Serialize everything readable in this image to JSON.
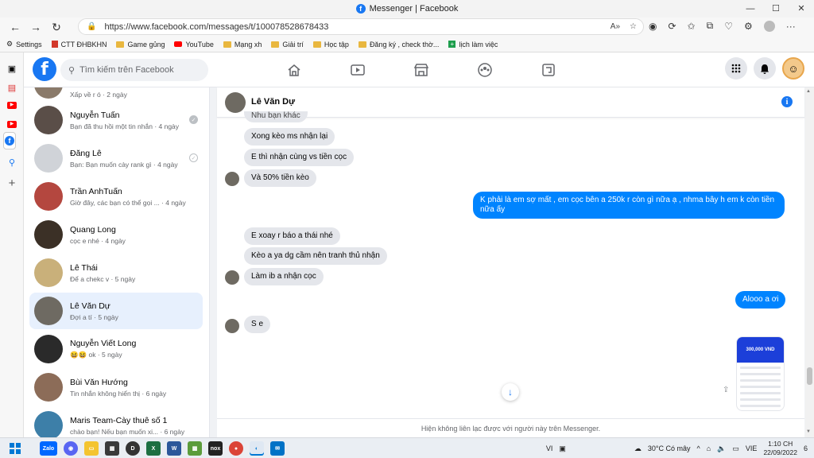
{
  "window": {
    "title": "Messenger | Facebook",
    "controls": [
      "—",
      "☐",
      "✕"
    ]
  },
  "browser": {
    "url": "https://www.facebook.com/messages/t/100078528678433"
  },
  "bookmarks": [
    {
      "label": "Settings",
      "icon": "gear-icon"
    },
    {
      "label": "CTT ĐHBKHN",
      "icon": "ctt-icon"
    },
    {
      "label": "Game gủng",
      "icon": "folder-icon"
    },
    {
      "label": "YouTube",
      "icon": "youtube-icon"
    },
    {
      "label": "Mạng xh",
      "icon": "folder-icon"
    },
    {
      "label": "Giải trí",
      "icon": "folder-icon"
    },
    {
      "label": "Học tập",
      "icon": "folder-icon"
    },
    {
      "label": "Đăng ký , check thờ...",
      "icon": "folder-icon"
    },
    {
      "label": "lịch làm việc",
      "icon": "sheet-icon"
    }
  ],
  "facebook": {
    "search_placeholder": "Tìm kiếm trên Facebook",
    "nav": [
      "home-icon",
      "watch-icon",
      "marketplace-icon",
      "groups-icon",
      "gaming-icon"
    ],
    "header_right": [
      "menu-grid-icon",
      "messenger-icon",
      "profile-avatar"
    ]
  },
  "conversations": {
    "partial_top": "Xấp về r ó · 2 ngày",
    "items": [
      {
        "name": "Nguyễn Tuấn",
        "preview": "Bạn đã thu hồi một tin nhắn · 4 ngày",
        "status": "seen-grey",
        "avatar_color": "#5a4e48"
      },
      {
        "name": "Đăng Lê",
        "preview": "Bạn: Bạn muốn cày rank gì · 4 ngày",
        "status": "sent-outline",
        "avatar_color": "#d0d3d8"
      },
      {
        "name": "Trần AnhTuấn",
        "preview": "Giờ đây, các bạn có thể gọi ... · 4 ngày",
        "status": "",
        "avatar_color": "#b4473f"
      },
      {
        "name": "Quang Long",
        "preview": "cọc e nhé · 4 ngày",
        "status": "",
        "avatar_color": "#3b3026"
      },
      {
        "name": "Lê Thái",
        "preview": "Để a chekc v · 5 ngày",
        "status": "",
        "avatar_color": "#c9b07a"
      },
      {
        "name": "Lê Văn Dự",
        "preview": "Đợi a tí · 5 ngày",
        "status": "",
        "avatar_color": "#6e6a62",
        "active": true
      },
      {
        "name": "Nguyễn Viết Long",
        "preview": "😆😆 ok · 5 ngày",
        "status": "",
        "avatar_color": "#2a2a2a"
      },
      {
        "name": "Bùi Văn Hướng",
        "preview": "Tin nhắn không hiển thị · 6 ngày",
        "status": "",
        "avatar_color": "#8c6c58"
      },
      {
        "name": "Maris Team-Cày thuê số 1",
        "preview": "chào bạn! Nếu bạn muốn xi... · 6 ngày",
        "status": "",
        "avatar_color": "#3d7fa8"
      }
    ]
  },
  "chat": {
    "contact_name": "Lê Văn Dự",
    "messages": [
      {
        "text": "Nhu bạn khác",
        "dir": "in"
      },
      {
        "text": "Xong kèo ms nhận lại",
        "dir": "in"
      },
      {
        "text": "E thì nhận cùng vs tiền cọc",
        "dir": "in"
      },
      {
        "text": "Và 50% tiền kèo",
        "dir": "in"
      },
      {
        "text": "K phải là em sợ mất , em cọc bên a 250k r còn gì nữa ạ , nhma bây h em k còn tiền nữa ấy",
        "dir": "out"
      },
      {
        "text": "E xoay r báo a thái nhé",
        "dir": "in"
      },
      {
        "text": "Kèo a ya dg cầm nên tranh thủ nhận",
        "dir": "in"
      },
      {
        "text": "Làm ib a nhận cọc",
        "dir": "in"
      },
      {
        "text": "Alooo a ơi",
        "dir": "out"
      },
      {
        "text": "S e",
        "dir": "in"
      }
    ],
    "payment_image_amount": "300,000 VND",
    "footer_note": "Hiện không liên lạc được với người này trên Messenger."
  },
  "taskbar": {
    "apps": [
      "windows-start",
      "zalo",
      "discord",
      "file-explorer",
      "store",
      "dell",
      "excel",
      "word",
      "minecraft",
      "nox",
      "chrome",
      "edge",
      "mail"
    ],
    "lang": "VI",
    "weather": "30°C  Có mây",
    "keyboard": "VIE",
    "time": "1:10 CH",
    "date": "22/09/2022",
    "notifications": "6"
  }
}
